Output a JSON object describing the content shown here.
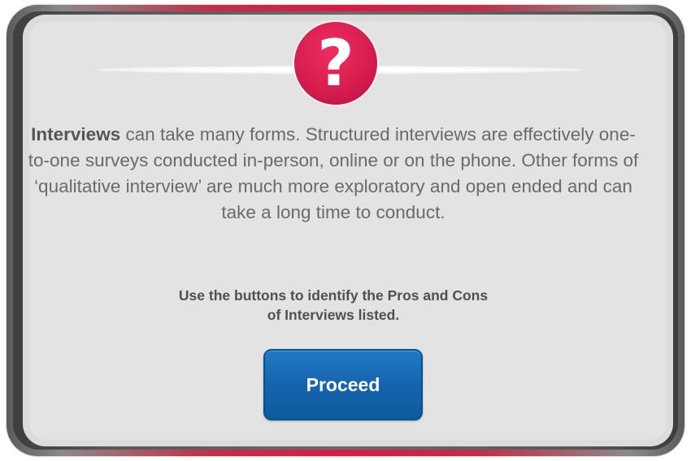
{
  "dialog": {
    "icon": "question-mark-icon",
    "icon_glyph": "?",
    "body_bold": "Interviews",
    "body_text": " can take many forms. Structured interviews are effectively one-to-one surveys conducted in-person, online or on the phone. Other forms of ‘qualitative interview’ are much more exploratory and open ended and can take a long time to conduct.",
    "instruction_line1": "Use the buttons to identify the Pros and Cons",
    "instruction_line2": "of Interviews listed.",
    "proceed_label": "Proceed"
  },
  "colors": {
    "accent": "#d71d4f",
    "button": "#1565ad",
    "panel": "#e3e3e3",
    "text": "#6a6a6a"
  }
}
